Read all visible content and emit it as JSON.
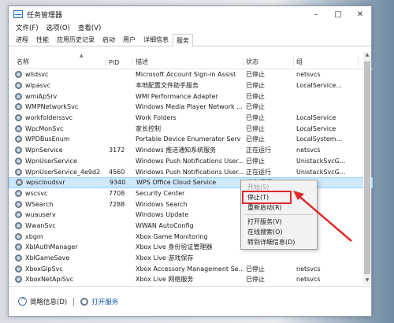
{
  "window": {
    "title": "任务管理器"
  },
  "menu": [
    "文件(F)",
    "选项(O)",
    "查看(V)"
  ],
  "tabs": [
    "进程",
    "性能",
    "应用历史记录",
    "启动",
    "用户",
    "详细信息",
    "服务"
  ],
  "active_tab": 6,
  "columns": {
    "name": "名称",
    "pid": "PID",
    "desc": "描述",
    "status": "状态",
    "group": "组"
  },
  "rows": [
    {
      "name": "wlidsvc",
      "pid": "",
      "desc": "Microsoft Account Sign-in Assist",
      "status": "已停止",
      "group": "netsvcs"
    },
    {
      "name": "wlpasvc",
      "pid": "",
      "desc": "本地配置文件助手服务",
      "status": "已停止",
      "group": "LocalService..."
    },
    {
      "name": "wmiApSrv",
      "pid": "",
      "desc": "WMI Performance Adapter",
      "status": "已停止",
      "group": ""
    },
    {
      "name": "WMPNetworkSvc",
      "pid": "",
      "desc": "Windows Media Player Network ...",
      "status": "已停止",
      "group": ""
    },
    {
      "name": "workfolderssvc",
      "pid": "",
      "desc": "Work Folders",
      "status": "已停止",
      "group": "LocalService"
    },
    {
      "name": "WpcMonSvc",
      "pid": "",
      "desc": "家长控制",
      "status": "已停止",
      "group": "LocalService"
    },
    {
      "name": "WPDBusEnum",
      "pid": "",
      "desc": "Portable Device Enumerator Serv",
      "status": "已停止",
      "group": "LocalSystem..."
    },
    {
      "name": "WpnService",
      "pid": "3172",
      "desc": "Windows 推送通知系统服务",
      "status": "正在运行",
      "group": "netsvcs"
    },
    {
      "name": "WpnUserService",
      "pid": "",
      "desc": "Windows Push Notifications User...",
      "status": "已停止",
      "group": "UnistackSvcG..."
    },
    {
      "name": "WpnUserService_4e9d2",
      "pid": "4560",
      "desc": "Windows Push Notifications User...",
      "status": "正在运行",
      "group": "UnistackSvcG..."
    },
    {
      "name": "wpscloudsvr",
      "pid": "9340",
      "desc": "WPS Office Cloud Service",
      "status": "正在运行",
      "group": ""
    },
    {
      "name": "wscsvc",
      "pid": "7708",
      "desc": "Security Center",
      "status": "",
      "group": ""
    },
    {
      "name": "WSearch",
      "pid": "7288",
      "desc": "Windows Search",
      "status": "",
      "group": ""
    },
    {
      "name": "wuauserv",
      "pid": "",
      "desc": "Windows Update",
      "status": "",
      "group": ""
    },
    {
      "name": "WwanSvc",
      "pid": "",
      "desc": "WWAN AutoConfig",
      "status": "",
      "group": ""
    },
    {
      "name": "xbgm",
      "pid": "",
      "desc": "Xbox Game Monitoring",
      "status": "",
      "group": ""
    },
    {
      "name": "XblAuthManager",
      "pid": "",
      "desc": "Xbox Live 身份验证管理器",
      "status": "",
      "group": ""
    },
    {
      "name": "XblGameSave",
      "pid": "",
      "desc": "Xbox Live 游戏保存",
      "status": "",
      "group": ""
    },
    {
      "name": "XboxGipSvc",
      "pid": "",
      "desc": "Xbox Accessory Management Se...",
      "status": "已停止",
      "group": "netsvcs"
    },
    {
      "name": "XboxNetApiSvc",
      "pid": "",
      "desc": "Xbox Live 网络服务",
      "status": "已停止",
      "group": "netsvcs"
    }
  ],
  "selected_row": 10,
  "context_menu": [
    {
      "label": "开始(S)",
      "disabled": true
    },
    {
      "label": "停止(T)",
      "disabled": false
    },
    {
      "label": "重新启动(R)",
      "disabled": false
    },
    {
      "sep": true
    },
    {
      "label": "打开服务(V)",
      "disabled": false
    },
    {
      "label": "在线搜索(O)",
      "disabled": false
    },
    {
      "label": "转到详细信息(D)",
      "disabled": false
    }
  ],
  "footer": {
    "less_details": "简略信息(D)",
    "open_services": "打开服务"
  },
  "colors": {
    "selection": "#cde8ff",
    "highlight": "#e02a2a",
    "link": "#1a5fb4"
  }
}
